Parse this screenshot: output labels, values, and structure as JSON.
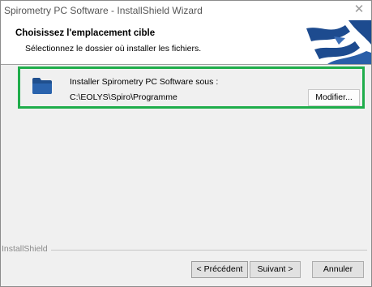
{
  "window": {
    "title": "Spirometry PC Software - InstallShield Wizard",
    "close_glyph": "✕"
  },
  "header": {
    "title": "Choisissez l'emplacement cible",
    "subtitle": "Sélectionnez le dossier où installer les fichiers."
  },
  "destination": {
    "label": "Installer Spirometry PC Software sous :",
    "path": "C:\\EOLYS\\Spiro\\Programme",
    "modify_button": "Modifier..."
  },
  "footer": {
    "brand": "InstallShield",
    "back_button": "< Précédent",
    "next_button": "Suivant >",
    "cancel_button": "Annuler"
  },
  "icons": {
    "folder": "folder-icon",
    "logo": "installshield-logo-icon"
  },
  "colors": {
    "highlight": "#1fad4b",
    "folder": "#1f4f8e",
    "logo": "#1d4b8f"
  }
}
